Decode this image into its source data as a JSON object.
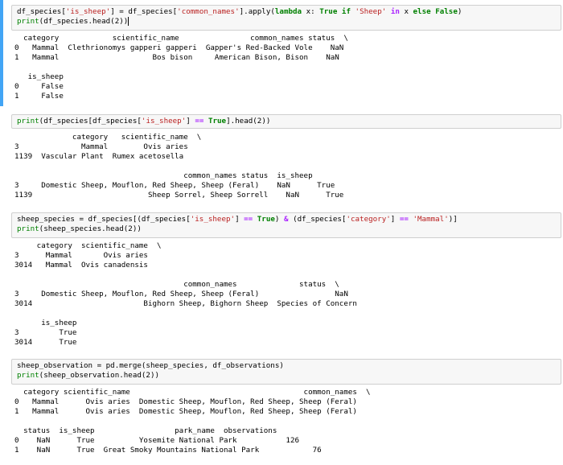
{
  "cells": [
    {
      "id": "cell-1",
      "selected": true,
      "code": [
        [
          {
            "t": "df_species[",
            "c": ""
          },
          {
            "t": "'is_sheep'",
            "c": "str"
          },
          {
            "t": "] = df_species[",
            "c": ""
          },
          {
            "t": "'common_names'",
            "c": "str"
          },
          {
            "t": "].apply(",
            "c": ""
          },
          {
            "t": "lambda",
            "c": "kw-lambda"
          },
          {
            "t": " x: ",
            "c": ""
          },
          {
            "t": "True",
            "c": "kw-const"
          },
          {
            "t": " ",
            "c": ""
          },
          {
            "t": "if",
            "c": "kw-const"
          },
          {
            "t": " ",
            "c": ""
          },
          {
            "t": "'Sheep'",
            "c": "str"
          },
          {
            "t": " ",
            "c": ""
          },
          {
            "t": "in",
            "c": "kw-op"
          },
          {
            "t": " x ",
            "c": ""
          },
          {
            "t": "else",
            "c": "kw-const"
          },
          {
            "t": " ",
            "c": ""
          },
          {
            "t": "False",
            "c": "kw-const"
          },
          {
            "t": ")",
            "c": ""
          }
        ],
        [
          {
            "t": "print",
            "c": "kw-builtin"
          },
          {
            "t": "(df_species.head(2))",
            "c": ""
          }
        ]
      ],
      "output": "  category            scientific_name                common_names status  \\\n0   Mammal  Clethrionomys gapperi gapperi  Gapper's Red-Backed Vole    NaN\n1   Mammal                     Bos bison     American Bison, Bison    NaN\n\n   is_sheep\n0     False\n1     False"
    },
    {
      "id": "cell-2",
      "selected": false,
      "code": [
        [
          {
            "t": "print",
            "c": "kw-builtin"
          },
          {
            "t": "(df_species[df_species[",
            "c": ""
          },
          {
            "t": "'is_sheep'",
            "c": "str"
          },
          {
            "t": "] ",
            "c": ""
          },
          {
            "t": "==",
            "c": "kw-op"
          },
          {
            "t": " ",
            "c": ""
          },
          {
            "t": "True",
            "c": "kw-const"
          },
          {
            "t": "].head(2))",
            "c": ""
          }
        ]
      ],
      "output": "             category   scientific_name  \\\n3              Mammal        Ovis aries\n1139  Vascular Plant  Rumex acetosella\n\n                                      common_names status  is_sheep\n3     Domestic Sheep, Mouflon, Red Sheep, Sheep (Feral)    NaN      True\n1139                          Sheep Sorrel, Sheep Sorrell    NaN      True"
    },
    {
      "id": "cell-3",
      "selected": false,
      "code": [
        [
          {
            "t": "sheep_species = df_species[(df_species[",
            "c": ""
          },
          {
            "t": "'is_sheep'",
            "c": "str"
          },
          {
            "t": "] ",
            "c": ""
          },
          {
            "t": "==",
            "c": "kw-op"
          },
          {
            "t": " ",
            "c": ""
          },
          {
            "t": "True",
            "c": "kw-const"
          },
          {
            "t": ") ",
            "c": ""
          },
          {
            "t": "&",
            "c": "kw-op"
          },
          {
            "t": " (df_species[",
            "c": ""
          },
          {
            "t": "'category'",
            "c": "str"
          },
          {
            "t": "] ",
            "c": ""
          },
          {
            "t": "==",
            "c": "kw-op"
          },
          {
            "t": " ",
            "c": ""
          },
          {
            "t": "'Mammal'",
            "c": "str"
          },
          {
            "t": ")]",
            "c": ""
          }
        ],
        [
          {
            "t": "print",
            "c": "kw-builtin"
          },
          {
            "t": "(sheep_species.head(2))",
            "c": ""
          }
        ]
      ],
      "output": "     category  scientific_name  \\\n3      Mammal       Ovis aries\n3014   Mammal  Ovis canadensis\n\n                                      common_names              status  \\\n3     Domestic Sheep, Mouflon, Red Sheep, Sheep (Feral)                 NaN\n3014                         Bighorn Sheep, Bighorn Sheep  Species of Concern\n\n      is_sheep\n3         True\n3014      True"
    },
    {
      "id": "cell-4",
      "selected": false,
      "code": [
        [
          {
            "t": "sheep_observation = pd.merge(sheep_species, df_observations)",
            "c": ""
          }
        ],
        [
          {
            "t": "print",
            "c": "kw-builtin"
          },
          {
            "t": "(sheep_observation.head(2))",
            "c": ""
          }
        ]
      ],
      "output": "  category scientific_name                                       common_names  \\\n0   Mammal      Ovis aries  Domestic Sheep, Mouflon, Red Sheep, Sheep (Feral)\n1   Mammal      Ovis aries  Domestic Sheep, Mouflon, Red Sheep, Sheep (Feral)\n\n  status  is_sheep                  park_name  observations\n0    NaN      True          Yosemite National Park           126\n1    NaN      True  Great Smoky Mountains National Park            76"
    }
  ]
}
